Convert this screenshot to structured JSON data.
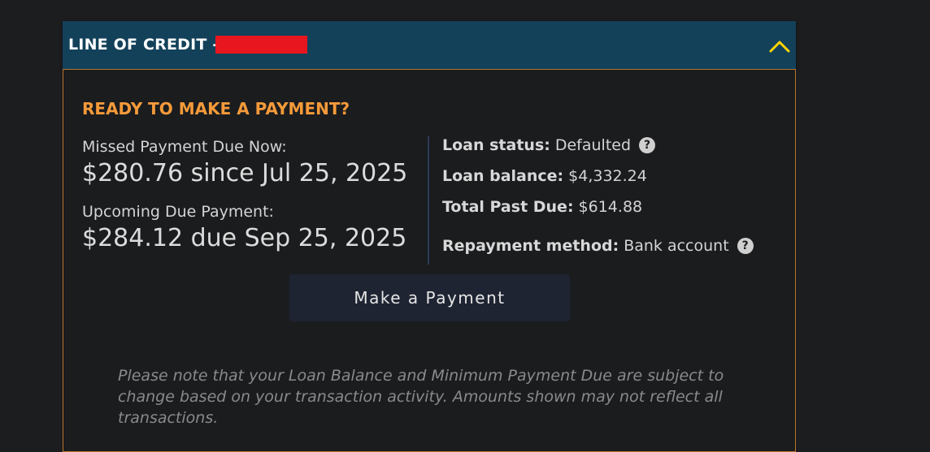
{
  "header": {
    "title": "LINE OF CREDIT -",
    "collapse_icon": "chevron-up-icon",
    "accent_color": "#ffd400",
    "header_bg": "#13415a"
  },
  "payment": {
    "heading": "READY TO MAKE A PAYMENT?",
    "heading_color": "#f59a3a",
    "missed_label": "Missed Payment Due Now:",
    "missed_value": "$280.76 since Jul 25, 2025",
    "upcoming_label": "Upcoming Due Payment:",
    "upcoming_value": "$284.12 due Sep 25, 2025"
  },
  "loan": {
    "status_label": "Loan status:",
    "status_value": "Defaulted",
    "balance_label": "Loan balance:",
    "balance_value": "$4,332.24",
    "past_due_label": "Total Past Due:",
    "past_due_value": "$614.88",
    "repayment_label": "Repayment method:",
    "repayment_value": "Bank account",
    "help_glyph": "?"
  },
  "actions": {
    "make_payment_label": "Make a Payment"
  },
  "note": {
    "text": "Please note that your Loan Balance and Minimum Payment Due are subject to change based on your transaction activity. Amounts shown may not reflect all transactions."
  }
}
